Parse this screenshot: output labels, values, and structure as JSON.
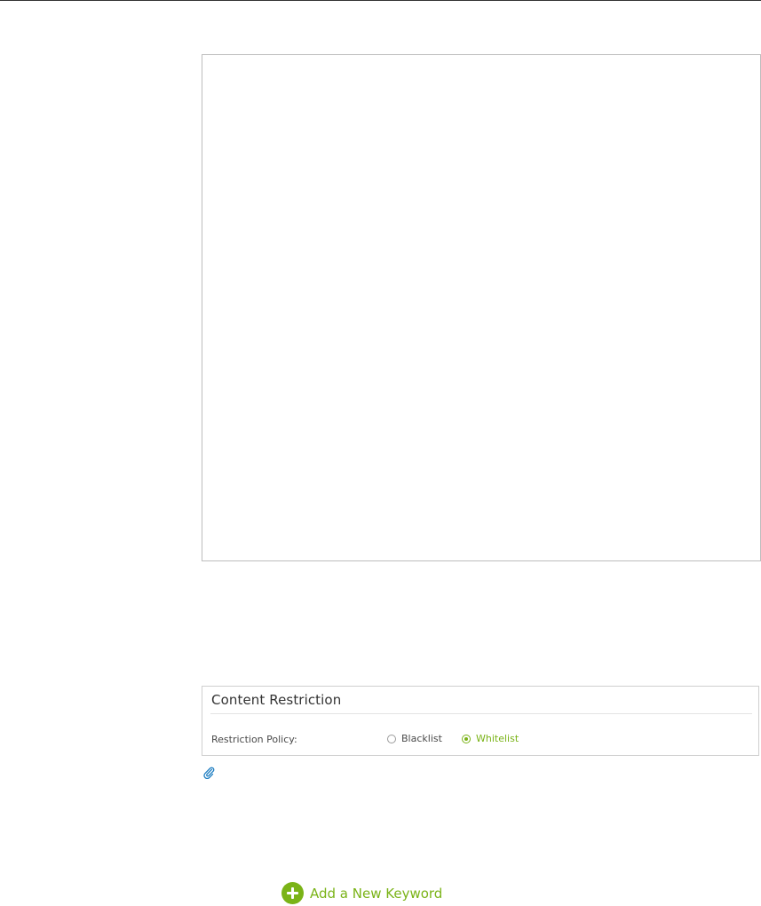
{
  "panel": {
    "title": "Content Restriction",
    "policy_label": "Restriction Policy:",
    "options": [
      {
        "label": "Blacklist",
        "selected": false
      },
      {
        "label": "Whitelist",
        "selected": true
      }
    ]
  },
  "actions": {
    "add_keyword_label": "Add a New Keyword"
  },
  "icons": {
    "note": "paperclip-icon",
    "add": "plus-circle-icon"
  },
  "colors": {
    "accent": "#7ab317",
    "note_icon": "#1f7ec2",
    "text": "#4a4a4a"
  }
}
